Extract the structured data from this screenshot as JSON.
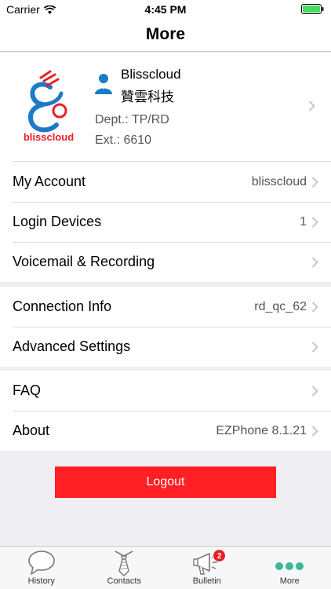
{
  "status": {
    "carrier": "Carrier",
    "time": "4:45 PM"
  },
  "nav": {
    "title": "More"
  },
  "profile": {
    "logo_text": "blisscloud",
    "name": "Blisscloud",
    "company": "贊雲科技",
    "dept": "Dept.: TP/RD",
    "ext": "Ext.: 6610"
  },
  "group1": [
    {
      "label": "My Account",
      "value": "blisscloud"
    },
    {
      "label": "Login Devices",
      "value": "1"
    },
    {
      "label": "Voicemail & Recording",
      "value": ""
    }
  ],
  "group2": [
    {
      "label": "Connection Info",
      "value": "rd_qc_62"
    },
    {
      "label": "Advanced Settings",
      "value": ""
    }
  ],
  "group3": [
    {
      "label": "FAQ",
      "value": ""
    },
    {
      "label": "About",
      "value": "EZPhone 8.1.21"
    }
  ],
  "logout_label": "Logout",
  "tabs": [
    {
      "label": "History",
      "icon": "speech-bubble-icon"
    },
    {
      "label": "Contacts",
      "icon": "necktie-icon"
    },
    {
      "label": "Bulletin",
      "icon": "megaphone-icon",
      "badge": "2"
    },
    {
      "label": "More",
      "icon": "more-dots-icon"
    }
  ],
  "colors": {
    "accent": "#ff1f24",
    "more_dots": "#3bb89a",
    "badge": "#e8202a"
  }
}
